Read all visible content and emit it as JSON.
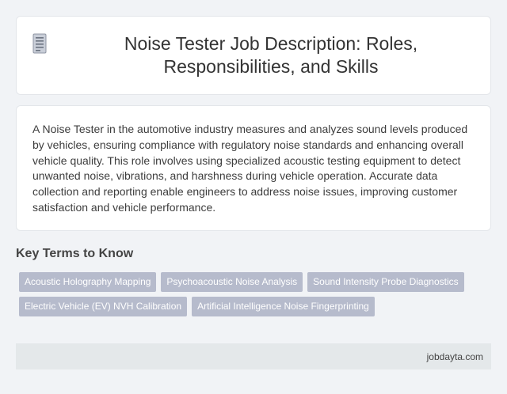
{
  "header": {
    "title": "Noise Tester Job Description: Roles, Responsibilities, and Skills",
    "icon": "document-icon"
  },
  "description": {
    "text": "A Noise Tester in the automotive industry measures and analyzes sound levels produced by vehicles, ensuring compliance with regulatory noise standards and enhancing overall vehicle quality. This role involves using specialized acoustic testing equipment to detect unwanted noise, vibrations, and harshness during vehicle operation. Accurate data collection and reporting enable engineers to address noise issues, improving customer satisfaction and vehicle performance."
  },
  "key_terms": {
    "heading": "Key Terms to Know",
    "tags": [
      "Acoustic Holography Mapping",
      "Psychoacoustic Noise Analysis",
      "Sound Intensity Probe Diagnostics",
      "Electric Vehicle (EV) NVH Calibration",
      "Artificial Intelligence Noise Fingerprinting"
    ]
  },
  "footer": {
    "site": "jobdayta.com"
  },
  "colors": {
    "background": "#f1f3f6",
    "card": "#ffffff",
    "tag": "#b6bbcc",
    "footer": "#e4e8ea"
  }
}
